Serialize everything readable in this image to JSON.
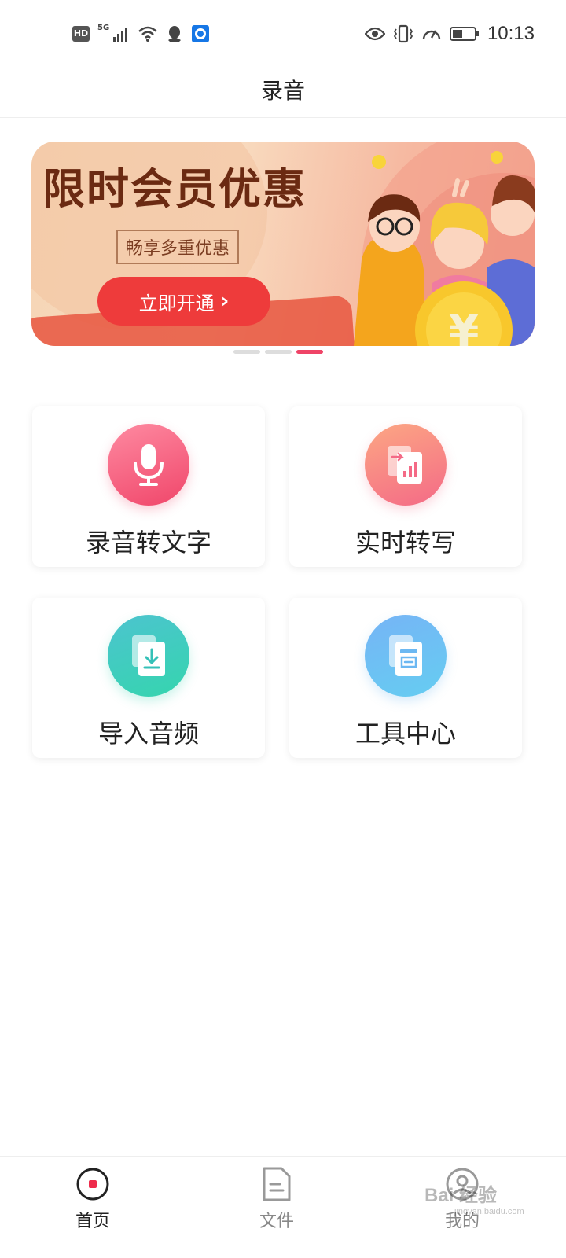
{
  "status_bar": {
    "hd": "HD",
    "network": "5G",
    "time": "10:13"
  },
  "header": {
    "title": "录音"
  },
  "banner": {
    "headline": "限时会员优惠",
    "tag": "畅享多重优惠",
    "cta_label": "立即开通",
    "slide_count": 3,
    "active_slide": 3
  },
  "features": [
    {
      "label": "录音转文字",
      "icon": "microphone-icon"
    },
    {
      "label": "实时转写",
      "icon": "realtime-transcribe-icon"
    },
    {
      "label": "导入音频",
      "icon": "import-audio-icon"
    },
    {
      "label": "工具中心",
      "icon": "tools-icon"
    }
  ],
  "bottom_nav": {
    "items": [
      {
        "label": "首页",
        "icon": "record-home-icon",
        "active": true
      },
      {
        "label": "文件",
        "icon": "file-icon",
        "active": false
      },
      {
        "label": "我的",
        "icon": "profile-icon",
        "active": false
      }
    ]
  },
  "watermark": {
    "text": "Bai 经验",
    "sub": "jingyan.baidu.com"
  },
  "colors": {
    "accent": "#ef4467",
    "cta": "#ee3b3b",
    "headline": "#6b2a12"
  }
}
